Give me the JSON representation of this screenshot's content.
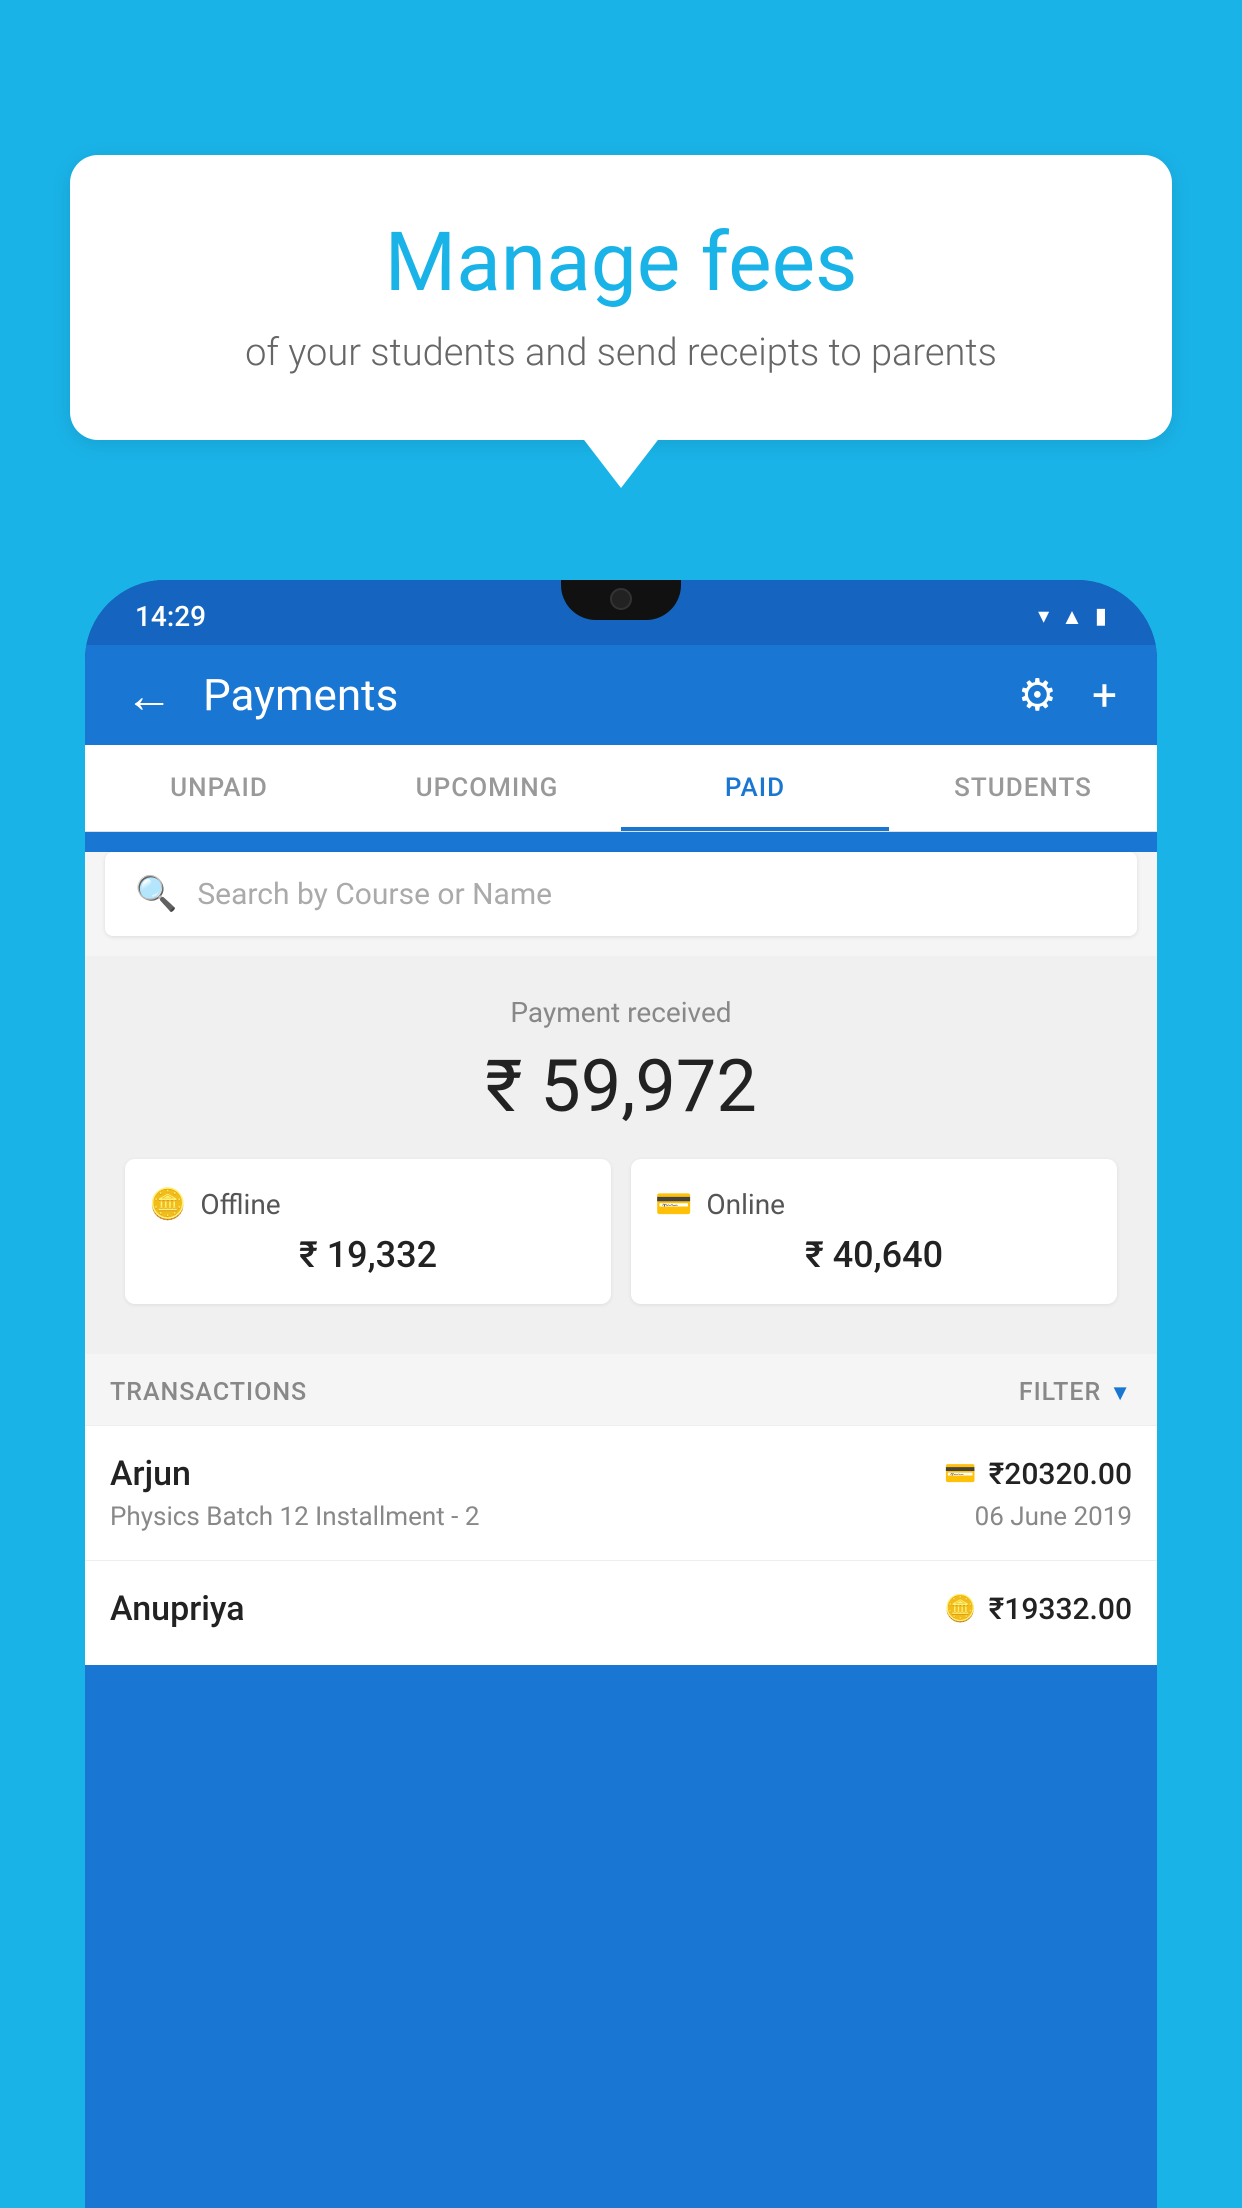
{
  "bubble": {
    "title": "Manage fees",
    "subtitle": "of your students and send receipts to parents"
  },
  "status_bar": {
    "time": "14:29",
    "icons": [
      "wifi",
      "signal",
      "battery"
    ]
  },
  "app_bar": {
    "title": "Payments",
    "back_label": "←",
    "gear_label": "⚙",
    "plus_label": "+"
  },
  "tabs": [
    {
      "label": "UNPAID",
      "active": false
    },
    {
      "label": "UPCOMING",
      "active": false
    },
    {
      "label": "PAID",
      "active": true
    },
    {
      "label": "STUDENTS",
      "active": false
    }
  ],
  "search": {
    "placeholder": "Search by Course or Name"
  },
  "payment_section": {
    "label": "Payment received",
    "amount": "₹ 59,972",
    "offline_label": "Offline",
    "offline_amount": "₹ 19,332",
    "online_label": "Online",
    "online_amount": "₹ 40,640"
  },
  "transactions": {
    "header": "TRANSACTIONS",
    "filter": "FILTER",
    "rows": [
      {
        "name": "Arjun",
        "amount": "₹20320.00",
        "course": "Physics Batch 12 Installment - 2",
        "date": "06 June 2019",
        "payment_type": "online"
      },
      {
        "name": "Anupriya",
        "amount": "₹19332.00",
        "course": "",
        "date": "",
        "payment_type": "offline"
      }
    ]
  },
  "colors": {
    "primary": "#1976d2",
    "background": "#1ab3e8",
    "accent": "#1ab3e8"
  }
}
